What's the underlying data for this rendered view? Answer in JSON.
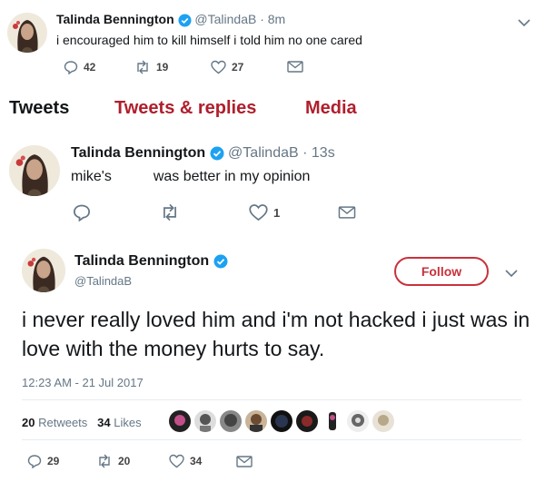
{
  "tweet1": {
    "name": "Talinda Bennington",
    "handle": "@TalindaB",
    "time": "· 8m",
    "text": "i encouraged him to kill himself i told him no one cared",
    "replies": "42",
    "retweets": "19",
    "likes": "27"
  },
  "tabs": {
    "tweets": "Tweets",
    "tweets_replies": "Tweets & replies",
    "media": "Media"
  },
  "tweet2": {
    "name": "Talinda Bennington",
    "handle": "@TalindaB",
    "time": "· 13s",
    "text_start": "mike's",
    "text_end": "was better in my opinion",
    "likes": "1"
  },
  "tweet3": {
    "name": "Talinda Bennington",
    "handle": "@TalindaB",
    "follow_label": "Follow",
    "text": "i never really loved him and i'm not hacked i just was in love with the money hurts to say.",
    "timestamp": "12:23 AM - 21 Jul 2017",
    "retweets_count": "20",
    "retweets_label": "Retweets",
    "likes_count": "34",
    "likes_label": "Likes",
    "reply_count": "29",
    "retweet_count": "20",
    "like_count": "34"
  },
  "icons": [
    "verified-icon",
    "reply-icon",
    "retweet-icon",
    "like-icon",
    "message-icon",
    "chevron-down-icon"
  ],
  "colors": {
    "verified": "#1da1f2",
    "accent_tab": "#b01e2c",
    "follow": "#c8323c",
    "muted": "#657786"
  }
}
